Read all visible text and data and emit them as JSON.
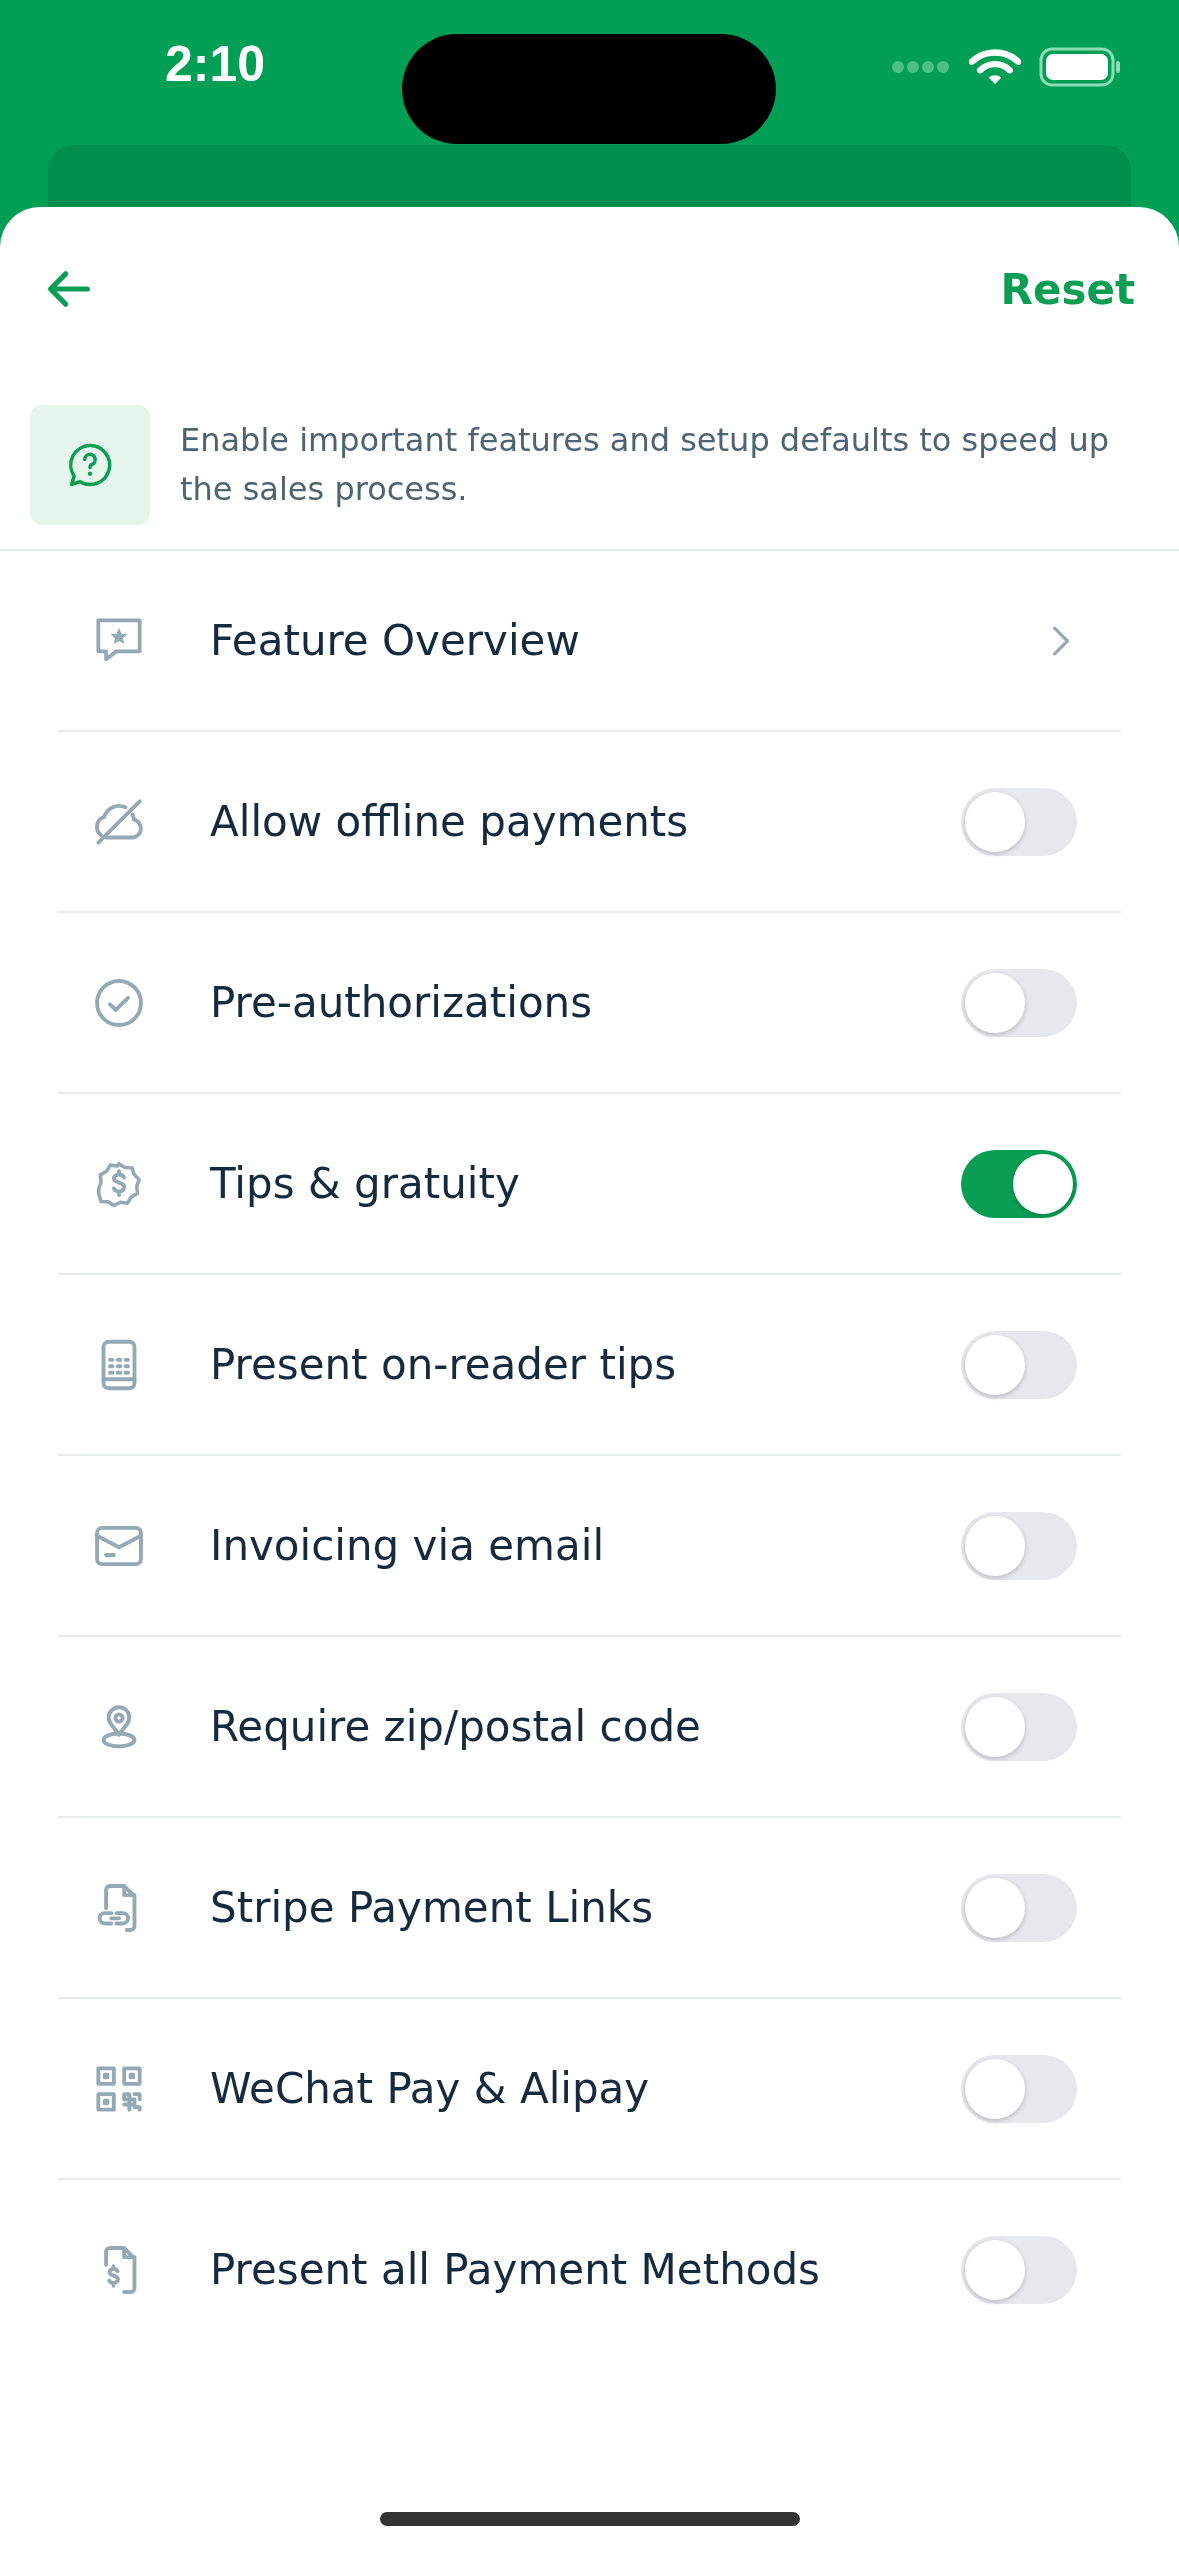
{
  "status_bar": {
    "time": "2:10"
  },
  "header": {
    "reset": "Reset"
  },
  "info": {
    "text": "Enable important features and setup defaults to speed up the sales process."
  },
  "settings": [
    {
      "label": "Feature Overview",
      "kind": "link"
    },
    {
      "label": "Allow offline payments",
      "kind": "toggle",
      "on": false
    },
    {
      "label": "Pre-authorizations",
      "kind": "toggle",
      "on": false
    },
    {
      "label": "Tips & gratuity",
      "kind": "toggle",
      "on": true
    },
    {
      "label": "Present on-reader tips",
      "kind": "toggle",
      "on": false
    },
    {
      "label": "Invoicing via email",
      "kind": "toggle",
      "on": false
    },
    {
      "label": "Require zip/postal code",
      "kind": "toggle",
      "on": false
    },
    {
      "label": "Stripe Payment Links",
      "kind": "toggle",
      "on": false
    },
    {
      "label": "WeChat Pay & Alipay",
      "kind": "toggle",
      "on": false
    },
    {
      "label": "Present all Payment Methods",
      "kind": "toggle",
      "on": false
    }
  ]
}
